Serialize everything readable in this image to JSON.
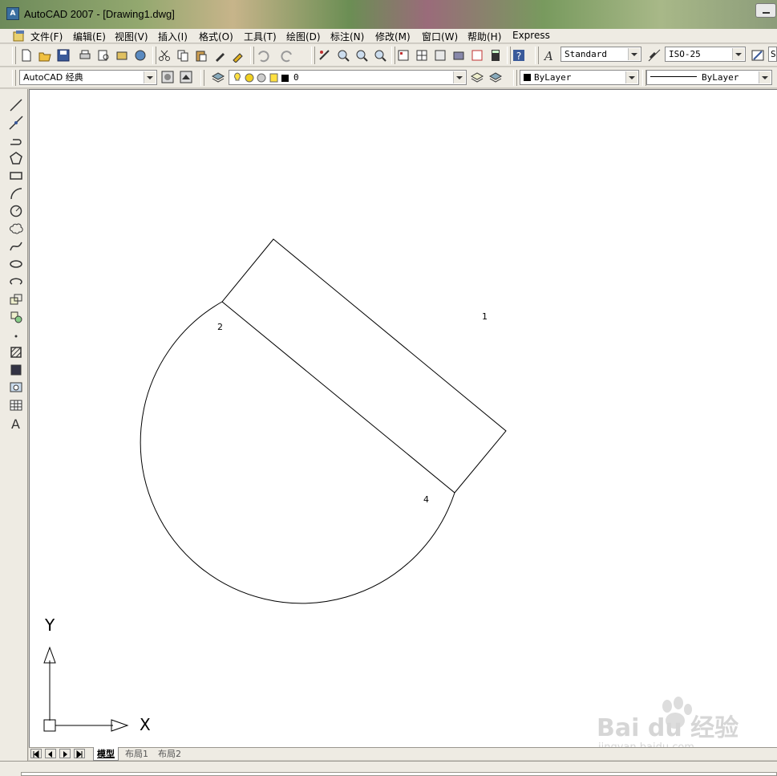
{
  "window": {
    "title": "AutoCAD 2007 - [Drawing1.dwg]",
    "app_icon_text": "A"
  },
  "menu": [
    "文件(F)",
    "编辑(E)",
    "视图(V)",
    "插入(I)",
    "格式(O)",
    "工具(T)",
    "绘图(D)",
    "标注(N)",
    "修改(M)",
    "窗口(W)",
    "帮助(H)",
    "Express"
  ],
  "toolbar": {
    "text_style": "Standard",
    "dim_style": "ISO-25",
    "table_style_partial": "S",
    "workspace": "AutoCAD 经典",
    "layer": "0",
    "color": "ByLayer",
    "linetype": "ByLayer"
  },
  "canvas": {
    "labels": {
      "p1": "1",
      "p2": "2",
      "p4": "4"
    },
    "ucs": {
      "x": "X",
      "y": "Y"
    }
  },
  "tabs": [
    "模型",
    "布局1",
    "布局2"
  ],
  "watermark": {
    "brand": "Bai du 经验",
    "url": "jingyan.baidu.com"
  }
}
